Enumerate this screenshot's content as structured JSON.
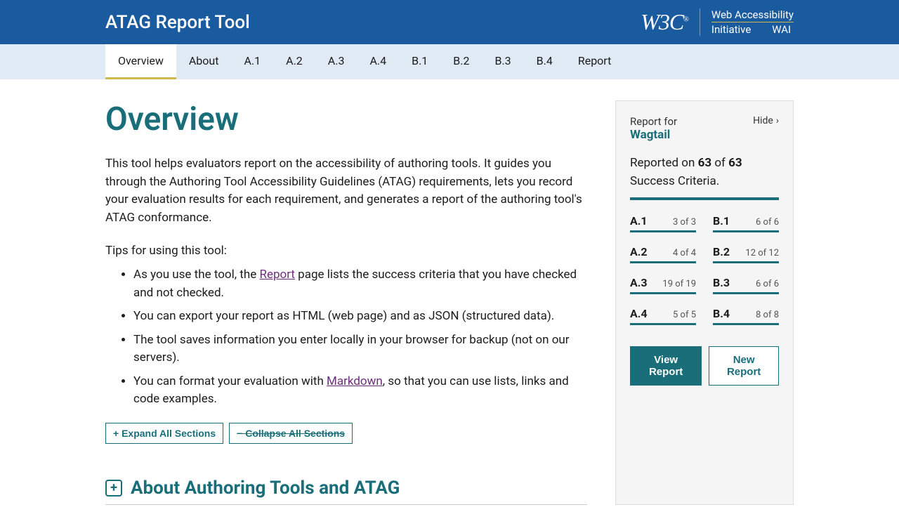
{
  "header": {
    "title": "ATAG Report Tool",
    "w3c": "W3C",
    "wai_line1": "Web Accessibility",
    "wai_initiative": "Initiative",
    "wai": "WAI"
  },
  "nav": {
    "items": [
      "Overview",
      "About",
      "A.1",
      "A.2",
      "A.3",
      "A.4",
      "B.1",
      "B.2",
      "B.3",
      "B.4",
      "Report"
    ]
  },
  "main": {
    "title": "Overview",
    "intro": "This tool helps evaluators report on the accessibility of authoring tools. It guides you through the Authoring Tool Accessibility Guidelines (ATAG) requirements, lets you record your evaluation results for each requirement, and generates a report of the authoring tool's ATAG conformance.",
    "tips_label": "Tips for using this tool:",
    "tips": {
      "t1_pre": "As you use the tool, the ",
      "t1_link": "Report",
      "t1_post": " page lists the success criteria that you have checked and not checked.",
      "t2": "You can export your report as HTML (web page) and as JSON (structured data).",
      "t3": "The tool saves information you enter locally in your browser for backup (not on our servers).",
      "t4_pre": "You can format your evaluation with ",
      "t4_link": "Markdown",
      "t4_post": ", so that you can use lists, links and code examples."
    },
    "expand_all": "+ Expand All Sections",
    "collapse_all": "− Collapse All Sections",
    "section1": "About Authoring Tools and ATAG"
  },
  "sidebar": {
    "report_for_label": "Report for",
    "report_for_name": "Wagtail",
    "hide": "Hide",
    "reported_pre": "Reported on ",
    "reported_n": "63",
    "reported_mid": " of ",
    "reported_total": "63",
    "reported_post": " Success Criteria.",
    "grid": [
      {
        "label": "A.1",
        "count": "3 of 3"
      },
      {
        "label": "B.1",
        "count": "6 of 6"
      },
      {
        "label": "A.2",
        "count": "4 of 4"
      },
      {
        "label": "B.2",
        "count": "12 of 12"
      },
      {
        "label": "A.3",
        "count": "19 of 19"
      },
      {
        "label": "B.3",
        "count": "6 of 6"
      },
      {
        "label": "A.4",
        "count": "5 of 5"
      },
      {
        "label": "B.4",
        "count": "8 of 8"
      }
    ],
    "view_report": "View Report",
    "new_report": "New Report"
  }
}
